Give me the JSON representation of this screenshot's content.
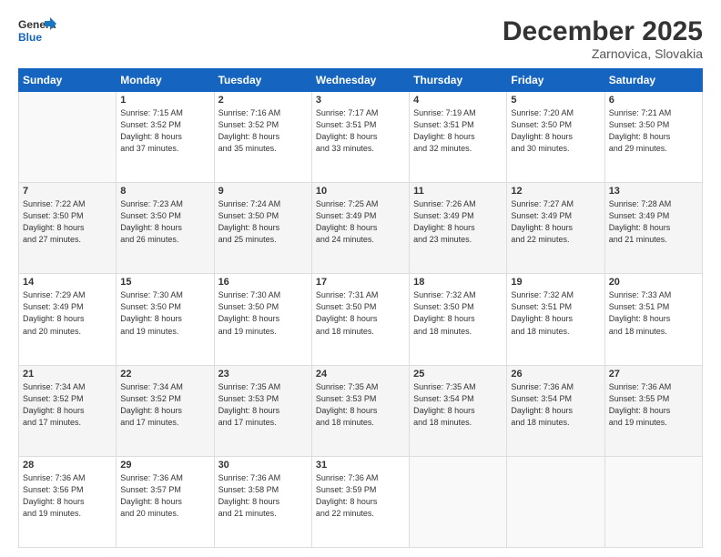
{
  "header": {
    "logo_line1": "General",
    "logo_line2": "Blue",
    "title": "December 2025",
    "subtitle": "Zarnovica, Slovakia"
  },
  "weekdays": [
    "Sunday",
    "Monday",
    "Tuesday",
    "Wednesday",
    "Thursday",
    "Friday",
    "Saturday"
  ],
  "weeks": [
    [
      {
        "day": "",
        "info": ""
      },
      {
        "day": "1",
        "info": "Sunrise: 7:15 AM\nSunset: 3:52 PM\nDaylight: 8 hours\nand 37 minutes."
      },
      {
        "day": "2",
        "info": "Sunrise: 7:16 AM\nSunset: 3:52 PM\nDaylight: 8 hours\nand 35 minutes."
      },
      {
        "day": "3",
        "info": "Sunrise: 7:17 AM\nSunset: 3:51 PM\nDaylight: 8 hours\nand 33 minutes."
      },
      {
        "day": "4",
        "info": "Sunrise: 7:19 AM\nSunset: 3:51 PM\nDaylight: 8 hours\nand 32 minutes."
      },
      {
        "day": "5",
        "info": "Sunrise: 7:20 AM\nSunset: 3:50 PM\nDaylight: 8 hours\nand 30 minutes."
      },
      {
        "day": "6",
        "info": "Sunrise: 7:21 AM\nSunset: 3:50 PM\nDaylight: 8 hours\nand 29 minutes."
      }
    ],
    [
      {
        "day": "7",
        "info": "Sunrise: 7:22 AM\nSunset: 3:50 PM\nDaylight: 8 hours\nand 27 minutes."
      },
      {
        "day": "8",
        "info": "Sunrise: 7:23 AM\nSunset: 3:50 PM\nDaylight: 8 hours\nand 26 minutes."
      },
      {
        "day": "9",
        "info": "Sunrise: 7:24 AM\nSunset: 3:50 PM\nDaylight: 8 hours\nand 25 minutes."
      },
      {
        "day": "10",
        "info": "Sunrise: 7:25 AM\nSunset: 3:49 PM\nDaylight: 8 hours\nand 24 minutes."
      },
      {
        "day": "11",
        "info": "Sunrise: 7:26 AM\nSunset: 3:49 PM\nDaylight: 8 hours\nand 23 minutes."
      },
      {
        "day": "12",
        "info": "Sunrise: 7:27 AM\nSunset: 3:49 PM\nDaylight: 8 hours\nand 22 minutes."
      },
      {
        "day": "13",
        "info": "Sunrise: 7:28 AM\nSunset: 3:49 PM\nDaylight: 8 hours\nand 21 minutes."
      }
    ],
    [
      {
        "day": "14",
        "info": "Sunrise: 7:29 AM\nSunset: 3:49 PM\nDaylight: 8 hours\nand 20 minutes."
      },
      {
        "day": "15",
        "info": "Sunrise: 7:30 AM\nSunset: 3:50 PM\nDaylight: 8 hours\nand 19 minutes."
      },
      {
        "day": "16",
        "info": "Sunrise: 7:30 AM\nSunset: 3:50 PM\nDaylight: 8 hours\nand 19 minutes."
      },
      {
        "day": "17",
        "info": "Sunrise: 7:31 AM\nSunset: 3:50 PM\nDaylight: 8 hours\nand 18 minutes."
      },
      {
        "day": "18",
        "info": "Sunrise: 7:32 AM\nSunset: 3:50 PM\nDaylight: 8 hours\nand 18 minutes."
      },
      {
        "day": "19",
        "info": "Sunrise: 7:32 AM\nSunset: 3:51 PM\nDaylight: 8 hours\nand 18 minutes."
      },
      {
        "day": "20",
        "info": "Sunrise: 7:33 AM\nSunset: 3:51 PM\nDaylight: 8 hours\nand 18 minutes."
      }
    ],
    [
      {
        "day": "21",
        "info": "Sunrise: 7:34 AM\nSunset: 3:52 PM\nDaylight: 8 hours\nand 17 minutes."
      },
      {
        "day": "22",
        "info": "Sunrise: 7:34 AM\nSunset: 3:52 PM\nDaylight: 8 hours\nand 17 minutes."
      },
      {
        "day": "23",
        "info": "Sunrise: 7:35 AM\nSunset: 3:53 PM\nDaylight: 8 hours\nand 17 minutes."
      },
      {
        "day": "24",
        "info": "Sunrise: 7:35 AM\nSunset: 3:53 PM\nDaylight: 8 hours\nand 18 minutes."
      },
      {
        "day": "25",
        "info": "Sunrise: 7:35 AM\nSunset: 3:54 PM\nDaylight: 8 hours\nand 18 minutes."
      },
      {
        "day": "26",
        "info": "Sunrise: 7:36 AM\nSunset: 3:54 PM\nDaylight: 8 hours\nand 18 minutes."
      },
      {
        "day": "27",
        "info": "Sunrise: 7:36 AM\nSunset: 3:55 PM\nDaylight: 8 hours\nand 19 minutes."
      }
    ],
    [
      {
        "day": "28",
        "info": "Sunrise: 7:36 AM\nSunset: 3:56 PM\nDaylight: 8 hours\nand 19 minutes."
      },
      {
        "day": "29",
        "info": "Sunrise: 7:36 AM\nSunset: 3:57 PM\nDaylight: 8 hours\nand 20 minutes."
      },
      {
        "day": "30",
        "info": "Sunrise: 7:36 AM\nSunset: 3:58 PM\nDaylight: 8 hours\nand 21 minutes."
      },
      {
        "day": "31",
        "info": "Sunrise: 7:36 AM\nSunset: 3:59 PM\nDaylight: 8 hours\nand 22 minutes."
      },
      {
        "day": "",
        "info": ""
      },
      {
        "day": "",
        "info": ""
      },
      {
        "day": "",
        "info": ""
      }
    ]
  ]
}
